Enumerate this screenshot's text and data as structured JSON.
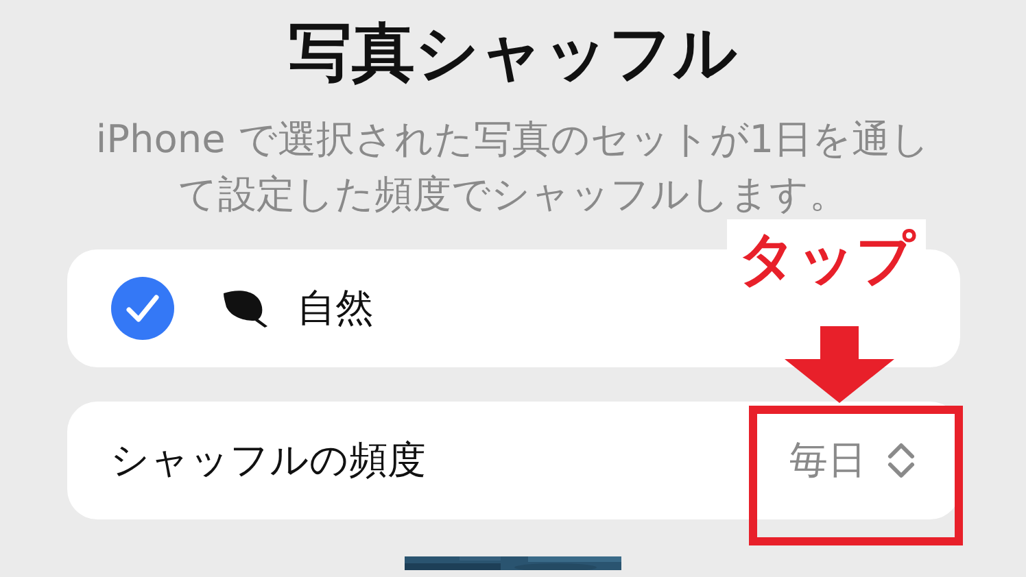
{
  "title": "写真シャッフル",
  "description": "iPhone で選択された写真のセットが1日を通して設定した頻度でシャッフルします。",
  "albums": [
    {
      "label": "自然",
      "checked": true
    }
  ],
  "frequency": {
    "label": "シャッフルの頻度",
    "value": "毎日"
  },
  "annotation": {
    "label": "タップ"
  }
}
